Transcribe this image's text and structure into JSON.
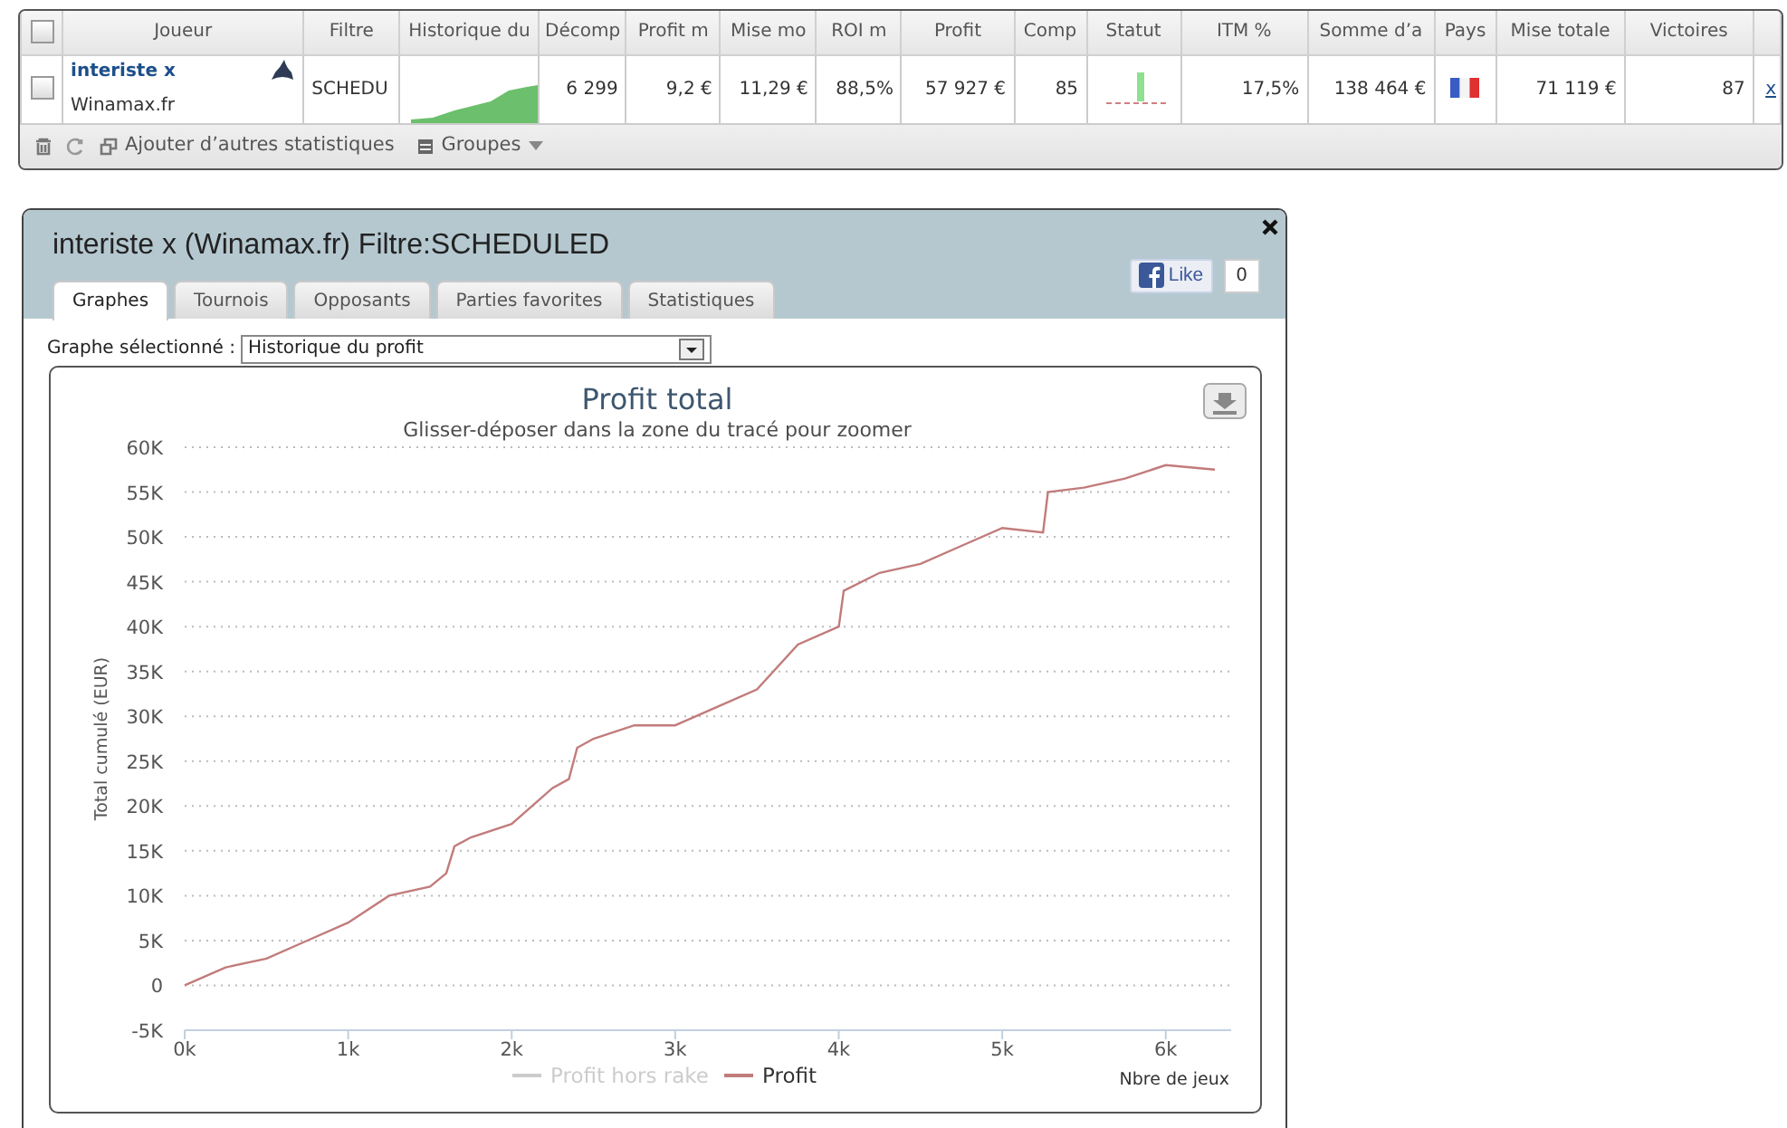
{
  "stats_table": {
    "all_selected": false,
    "columns": [
      "Joueur",
      "Filtre",
      "Historique du",
      "Décomp",
      "Profit m",
      "Mise mo",
      "ROI m",
      "Profit",
      "Comp",
      "Statut",
      "ITM %",
      "Somme d’a",
      "Pays",
      "Mise totale",
      "Victoires"
    ],
    "rows": [
      {
        "selected": false,
        "player": "interiste x",
        "site": "Winamax.fr",
        "filter": "SCHEDU",
        "count": "6 299",
        "avg_profit": "9,2 €",
        "avg_stake": "11,29 €",
        "roi": "88,5%",
        "profit": "57 927 €",
        "comp": "85",
        "itm": "17,5%",
        "sum": "138 464 €",
        "total_stake": "71 119 €",
        "wins": "87",
        "remove": "x"
      }
    ],
    "toolbar": {
      "add_stats": "Ajouter d’autres statistiques",
      "groups": "Groupes"
    }
  },
  "dialog": {
    "title": "interiste x (Winamax.fr) Filtre:SCHEDULED",
    "tabs": [
      {
        "label": "Graphes",
        "selected": true
      },
      {
        "label": "Tournois",
        "selected": false
      },
      {
        "label": "Opposants",
        "selected": false
      },
      {
        "label": "Parties favorites",
        "selected": false
      },
      {
        "label": "Statistiques",
        "selected": false
      }
    ],
    "like": {
      "label": "Like",
      "count": "0"
    },
    "graph_select": {
      "label": "Graphe sélectionné :",
      "value": "Historique du profit"
    },
    "chart": {
      "subtitle": "Glisser-déposer dans la zone du tracé pour zoomer",
      "hidden_legend": [
        {
          "label": "Profit hors rake",
          "visible": false
        }
      ],
      "chart_data": {
        "type": "line",
        "title": "Profit total",
        "xlabel": "Nbre de jeux",
        "ylabel": "Total cumulé (EUR)",
        "x": [
          0,
          250,
          500,
          750,
          1000,
          1250,
          1500,
          1600,
          1650,
          1750,
          2000,
          2250,
          2350,
          2400,
          2500,
          2750,
          3000,
          3250,
          3500,
          3750,
          4000,
          4030,
          4250,
          4500,
          4750,
          5000,
          5250,
          5280,
          5500,
          5750,
          6000,
          6300
        ],
        "series": [
          {
            "name": "Profit",
            "color": "#c27b7b",
            "values": [
              0,
              2000,
              3000,
              5000,
              7000,
              10000,
              11000,
              12500,
              15500,
              16500,
              18000,
              22000,
              23000,
              26500,
              27500,
              29000,
              29000,
              31000,
              33000,
              38000,
              40000,
              44000,
              46000,
              47000,
              49000,
              51000,
              50500,
              55000,
              55500,
              56500,
              58000,
              57500
            ]
          }
        ],
        "grid": true,
        "xlim": [
          0,
          6400
        ],
        "ylim": [
          -5000,
          60000
        ],
        "xticks": [
          {
            "value": 0,
            "label": "0k"
          },
          {
            "value": 1000,
            "label": "1k"
          },
          {
            "value": 2000,
            "label": "2k"
          },
          {
            "value": 3000,
            "label": "3k"
          },
          {
            "value": 4000,
            "label": "4k"
          },
          {
            "value": 5000,
            "label": "5k"
          },
          {
            "value": 6000,
            "label": "6k"
          }
        ],
        "yticks": [
          {
            "value": -5000,
            "label": "-5K"
          },
          {
            "value": 0,
            "label": "0"
          },
          {
            "value": 5000,
            "label": "5K"
          },
          {
            "value": 10000,
            "label": "10K"
          },
          {
            "value": 15000,
            "label": "15K"
          },
          {
            "value": 20000,
            "label": "20K"
          },
          {
            "value": 25000,
            "label": "25K"
          },
          {
            "value": 30000,
            "label": "30K"
          },
          {
            "value": 35000,
            "label": "35K"
          },
          {
            "value": 40000,
            "label": "40K"
          },
          {
            "value": 45000,
            "label": "45K"
          },
          {
            "value": 50000,
            "label": "50K"
          },
          {
            "value": 55000,
            "label": "55K"
          },
          {
            "value": 60000,
            "label": "60K"
          }
        ]
      }
    }
  }
}
